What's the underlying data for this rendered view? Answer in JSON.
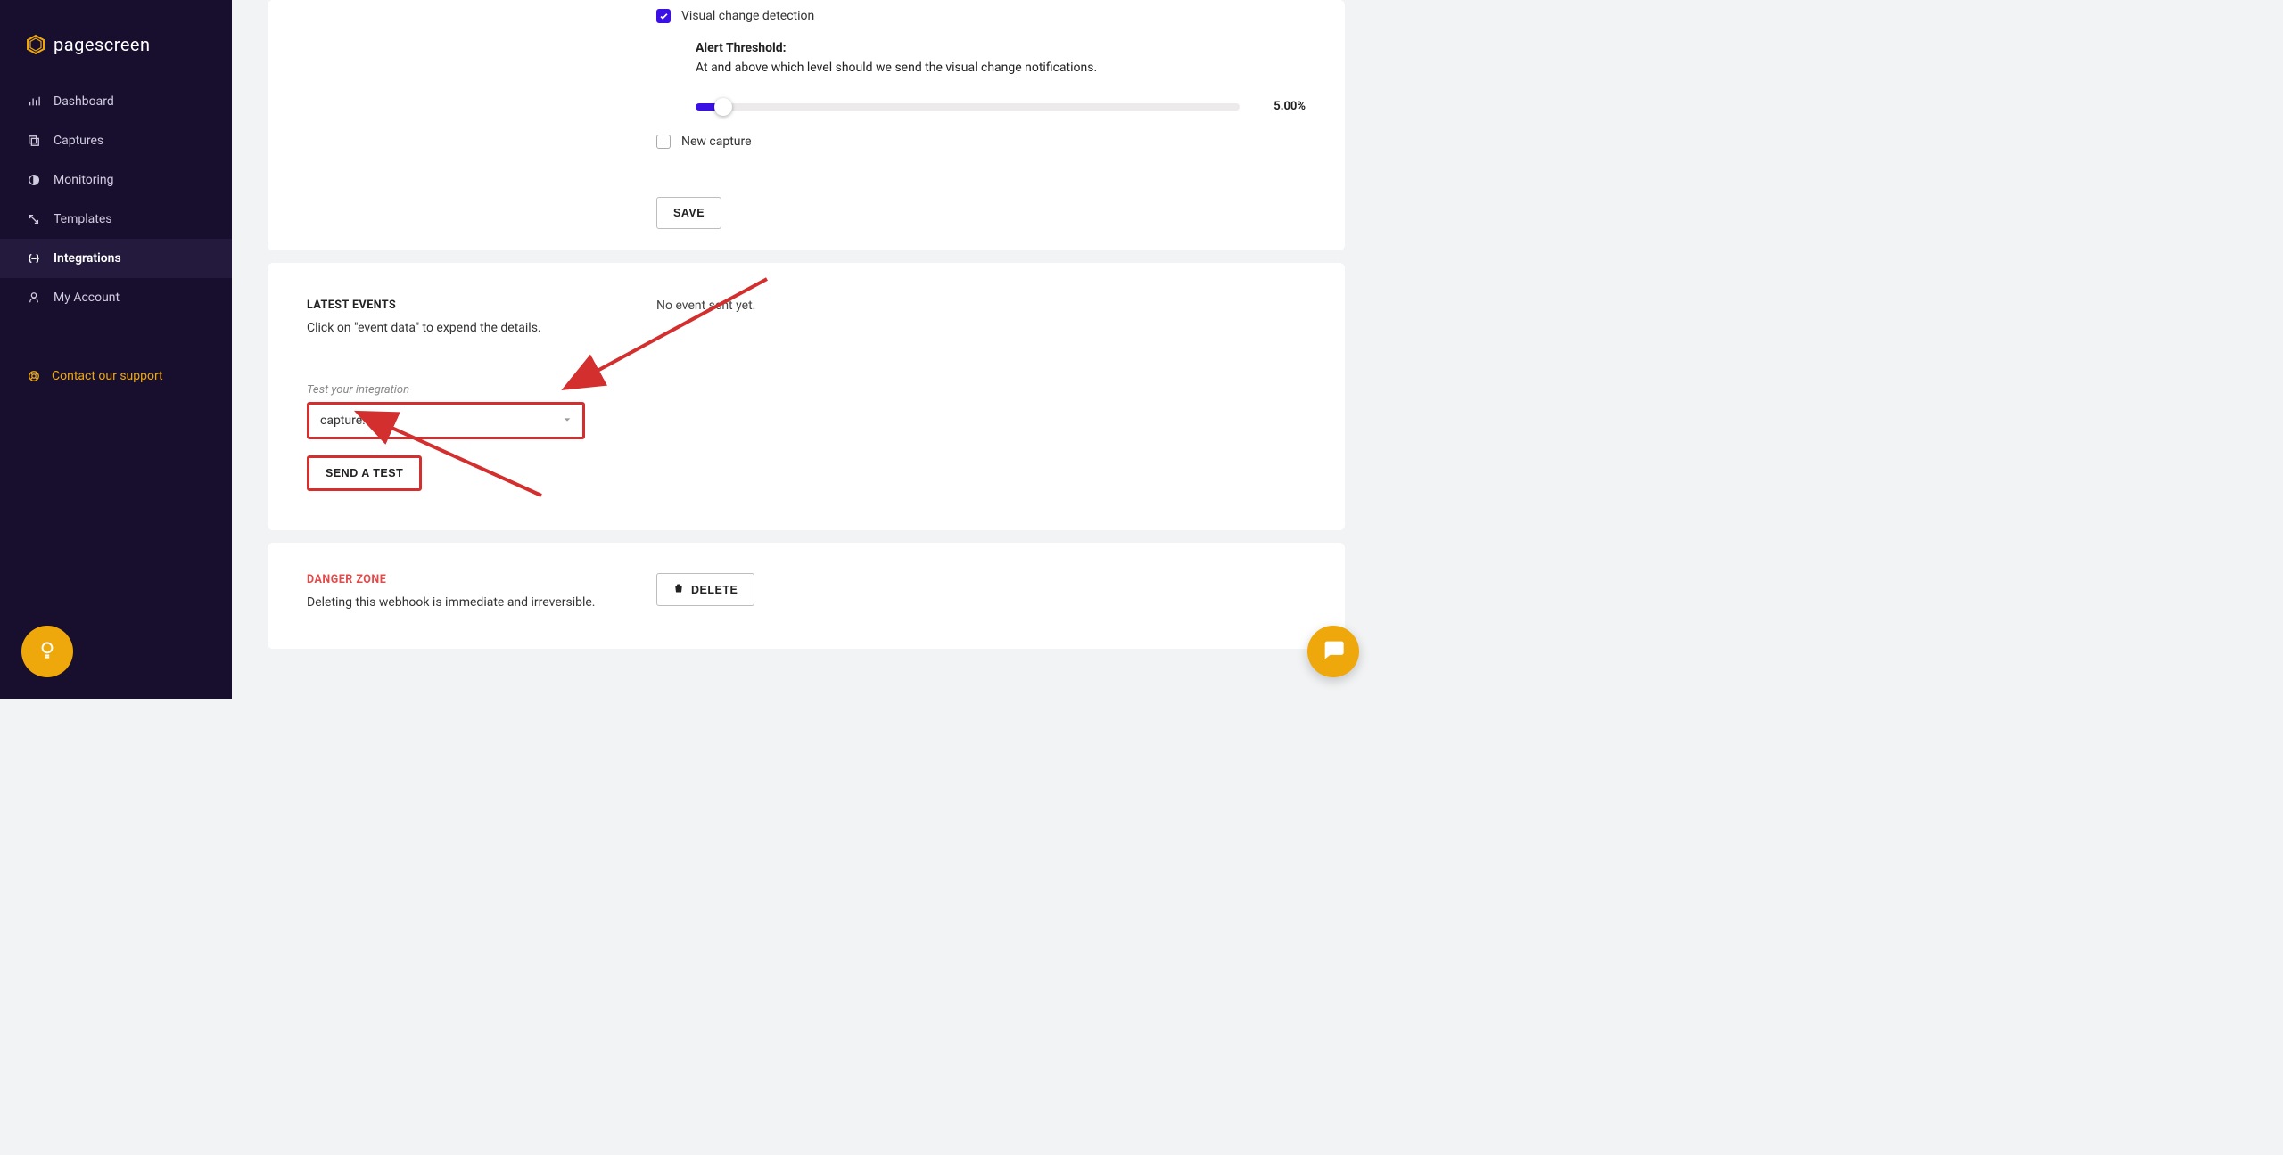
{
  "brand": {
    "name": "pagescreen"
  },
  "sidebar": {
    "items": [
      {
        "label": "Dashboard"
      },
      {
        "label": "Captures"
      },
      {
        "label": "Monitoring"
      },
      {
        "label": "Templates"
      },
      {
        "label": "Integrations",
        "active": true
      },
      {
        "label": "My Account"
      }
    ],
    "support_label": "Contact our support"
  },
  "settings": {
    "visual_change_label": "Visual change detection",
    "visual_change_checked": true,
    "alert_title": "Alert Threshold:",
    "alert_desc": "At and above which level should we send the visual change notifications.",
    "alert_value_display": "5.00%",
    "alert_value_percent": 5,
    "new_capture_label": "New capture",
    "new_capture_checked": false,
    "save_label": "SAVE"
  },
  "events": {
    "title": "LATEST EVENTS",
    "subtitle": "Click on \"event data\" to expend the details.",
    "empty_message": "No event sent yet.",
    "test_label": "Test your integration",
    "test_selected": "capture.new",
    "send_test_label": "SEND A TEST"
  },
  "danger": {
    "title": "DANGER ZONE",
    "subtitle": "Deleting this webhook is immediate and irreversible.",
    "delete_label": "DELETE"
  }
}
